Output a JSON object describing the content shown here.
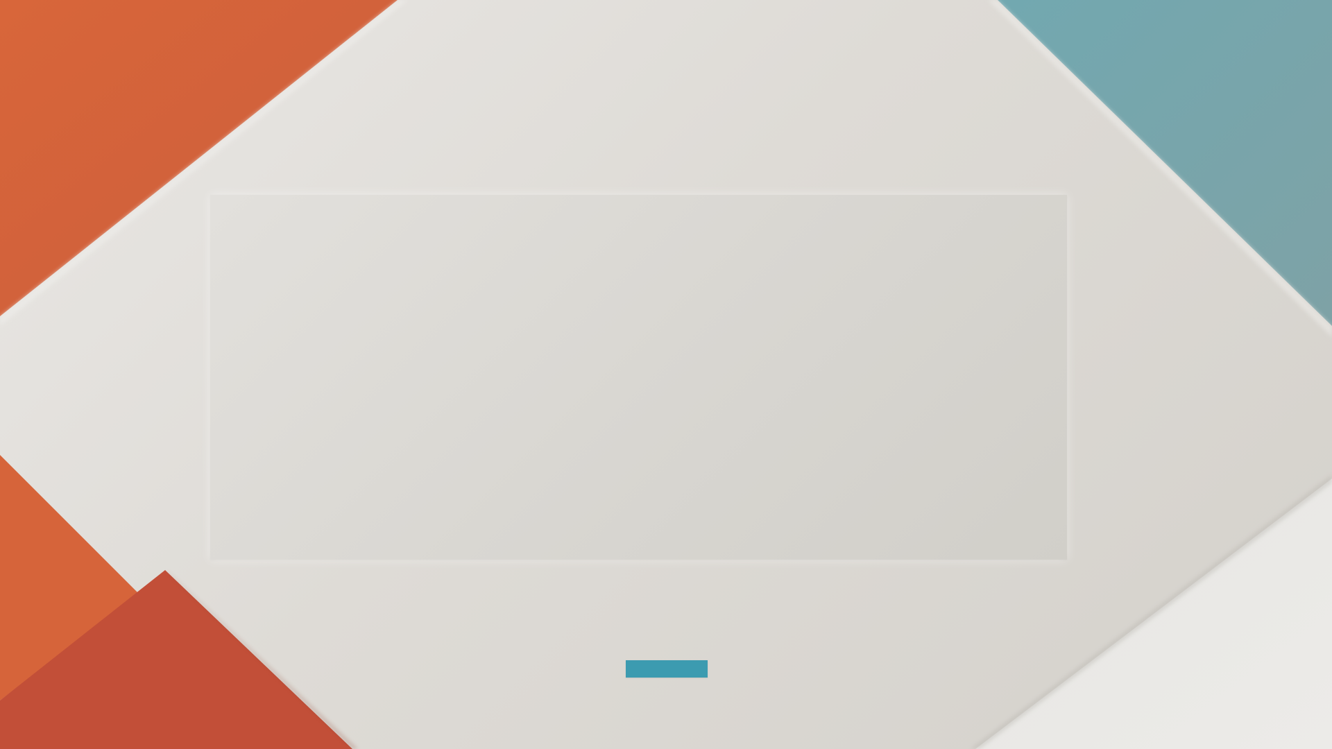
{
  "theme": {
    "background": "#dedbd6",
    "panel": "#d9d7d2",
    "accent_orange": "#d4623a",
    "accent_red_orange": "#c24f38",
    "accent_teal": "#79a7ae",
    "button": "#3c9bb0",
    "text_placeholder": "#6c6c6c"
  },
  "content": {
    "lines": [
      "",
      "",
      "",
      ""
    ],
    "button_label": ""
  }
}
